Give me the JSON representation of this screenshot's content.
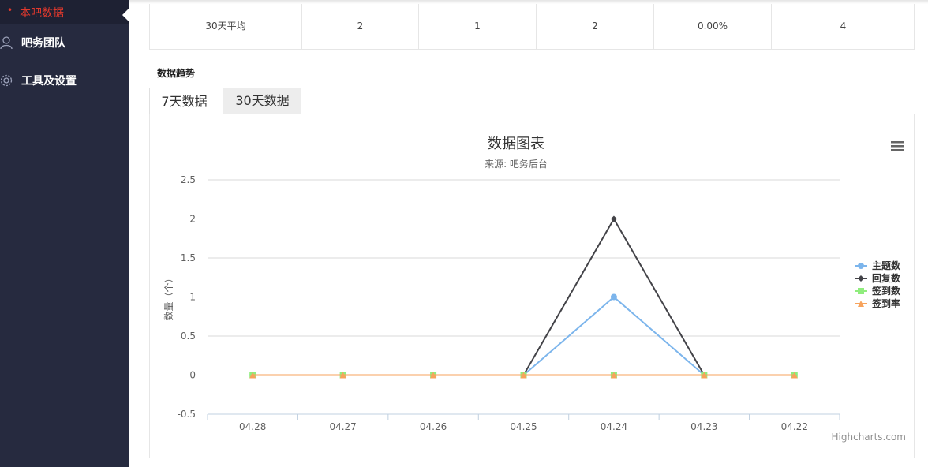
{
  "sidebar": {
    "active_label": "本吧数据",
    "items": [
      {
        "label": "吧务团队",
        "icon": "people-icon"
      },
      {
        "label": "工具及设置",
        "icon": "gear-icon"
      }
    ]
  },
  "stats": {
    "row_label": "30天平均",
    "values": [
      "2",
      "1",
      "2",
      "0.00%",
      "4"
    ]
  },
  "section_title": "数据趋势",
  "tabs": [
    {
      "label": "7天数据",
      "active": true
    },
    {
      "label": "30天数据",
      "active": false
    }
  ],
  "chart_menu_icon": "hamburger-menu-icon",
  "chart_data": {
    "type": "line",
    "title": "数据图表",
    "subtitle": "来源: 吧务后台",
    "ylabel": "数量（个）",
    "xlabel": "",
    "categories": [
      "04.28",
      "04.27",
      "04.26",
      "04.25",
      "04.24",
      "04.23",
      "04.22"
    ],
    "ylim": [
      -0.5,
      2.5
    ],
    "yticks": [
      "-0.5",
      "0",
      "0.5",
      "1",
      "1.5",
      "2",
      "2.5"
    ],
    "grid": true,
    "legend_position": "right",
    "series": [
      {
        "name": "主题数",
        "values": [
          0,
          0,
          0,
          0,
          1,
          0,
          0
        ],
        "color": "#7cb5ec",
        "marker": "circle"
      },
      {
        "name": "回复数",
        "values": [
          0,
          0,
          0,
          0,
          2,
          0,
          0
        ],
        "color": "#434348",
        "marker": "diamond"
      },
      {
        "name": "签到数",
        "values": [
          0,
          0,
          0,
          0,
          0,
          0,
          0
        ],
        "color": "#90ed7d",
        "marker": "square"
      },
      {
        "name": "签到率",
        "values": [
          0,
          0,
          0,
          0,
          0,
          0,
          0
        ],
        "color": "#f7a35c",
        "marker": "triangle"
      }
    ],
    "credits": "Highcharts.com"
  }
}
